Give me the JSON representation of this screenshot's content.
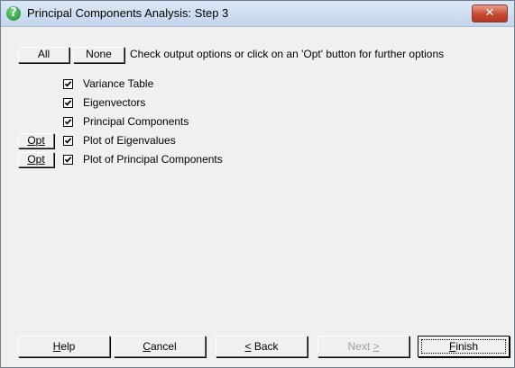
{
  "window": {
    "title": "Principal Components Analysis: Step 3",
    "close_label": "✕"
  },
  "top_buttons": {
    "all_label": "All",
    "none_label": "None"
  },
  "hint_text": "Check output options or click on an 'Opt' button for further options",
  "options": [
    {
      "label": "Variance Table",
      "checked": true,
      "opt_button": null
    },
    {
      "label": "Eigenvectors",
      "checked": true,
      "opt_button": null
    },
    {
      "label": "Principal Components",
      "checked": true,
      "opt_button": null
    },
    {
      "label": "Plot of Eigenvalues",
      "checked": true,
      "opt_button": "Opt"
    },
    {
      "label": "Plot of Principal Components",
      "checked": true,
      "opt_button": "Opt"
    }
  ],
  "footer": {
    "help": {
      "pre": "",
      "key": "H",
      "post": "elp",
      "enabled": true
    },
    "cancel": {
      "pre": "",
      "key": "C",
      "post": "ancel",
      "enabled": true
    },
    "back": {
      "pre": "",
      "key": "<",
      "post": " Back",
      "enabled": true
    },
    "next": {
      "pre": "Next ",
      "key": ">",
      "post": "",
      "enabled": false
    },
    "finish": {
      "pre": "",
      "key": "F",
      "post": "inish",
      "enabled": true,
      "default": true
    }
  }
}
